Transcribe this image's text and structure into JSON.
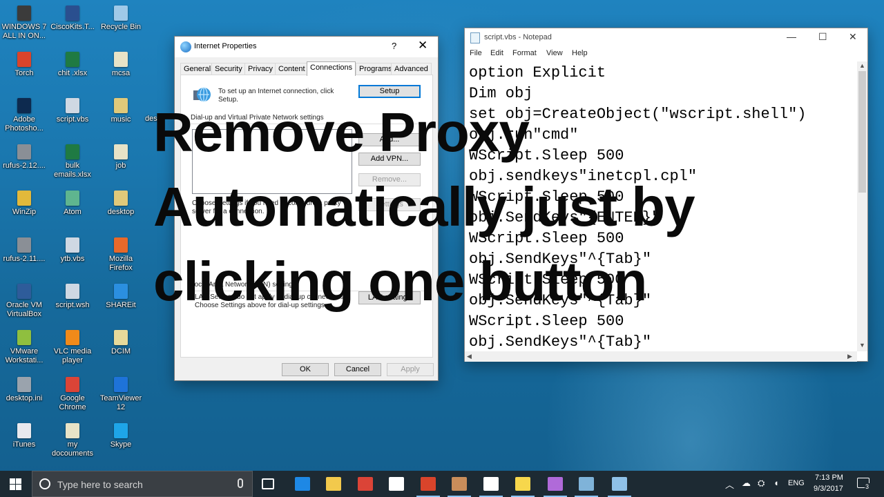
{
  "desktop": {
    "icons": [
      {
        "label": "WINDOWS 7 ALL IN ON...",
        "color": "#3b3b3b"
      },
      {
        "label": "CiscoKits.T...",
        "color": "#2a4f8f"
      },
      {
        "label": "Recycle Bin",
        "color": "#9fc9e8"
      },
      {
        "label": "Torch",
        "color": "#d9442b"
      },
      {
        "label": "chit .xlsx",
        "color": "#1f7a43"
      },
      {
        "label": "mcsa",
        "color": "#e7e3c7"
      },
      {
        "label": "Adobe Photosho...",
        "color": "#0d2a4f"
      },
      {
        "label": "script.vbs",
        "color": "#cfd8e3"
      },
      {
        "label": "music",
        "color": "#e0c97a"
      },
      {
        "label": "rufus-2.12....",
        "color": "#8a8f96"
      },
      {
        "label": "bulk emails.xlsx",
        "color": "#1f7a43"
      },
      {
        "label": "job",
        "color": "#e7e3c7"
      },
      {
        "label": "WinZip",
        "color": "#e2b93b"
      },
      {
        "label": "Atom",
        "color": "#5fb58f"
      },
      {
        "label": "desktop",
        "color": "#e0c97a"
      },
      {
        "label": "rufus-2.11....",
        "color": "#8a8f96"
      },
      {
        "label": "ytb.vbs",
        "color": "#cfd8e3"
      },
      {
        "label": "Mozilla Firefox",
        "color": "#e8692a"
      },
      {
        "label": "Oracle VM VirtualBox",
        "color": "#2e5c9a"
      },
      {
        "label": "script.wsh",
        "color": "#cfd8e3"
      },
      {
        "label": "SHAREit",
        "color": "#2b8fe0"
      },
      {
        "label": "VMware Workstati...",
        "color": "#8fbf3f"
      },
      {
        "label": "VLC media player",
        "color": "#f08a1a"
      },
      {
        "label": "DCIM",
        "color": "#e7d99a"
      },
      {
        "label": "desktop.ini",
        "color": "#9aa3ad"
      },
      {
        "label": "Google Chrome",
        "color": "#db4437"
      },
      {
        "label": "TeamViewer 12",
        "color": "#1e73d9"
      },
      {
        "label": "iTunes",
        "color": "#e9e9ee"
      },
      {
        "label": "my docouments",
        "color": "#e7e3c7"
      },
      {
        "label": "Skype",
        "color": "#1ea5e8"
      }
    ],
    "partial_label": "des"
  },
  "dialog": {
    "title": "Internet Properties",
    "help": "?",
    "close": "✕",
    "tabs": [
      "General",
      "Security",
      "Privacy",
      "Content",
      "Connections",
      "Programs",
      "Advanced"
    ],
    "active_tab": "Connections",
    "setup_text": "To set up an Internet connection, click Setup.",
    "setup_button": "Setup",
    "dialup_heading": "Dial-up and Virtual Private Network settings",
    "add_button": "Add...",
    "add_vpn_button": "Add VPN...",
    "remove_button": "Remove...",
    "settings_button": "Settings",
    "proxy_text": "Choose Settings if you need to configure a proxy server for a connection.",
    "lan_heading": "Local Area Network (LAN) settings",
    "lan_text": "LAN Settings do not apply to dial-up connections. Choose Settings above for dial-up settings.",
    "lan_button": "LAN settings",
    "ok": "OK",
    "cancel": "Cancel",
    "apply": "Apply"
  },
  "notepad": {
    "title": "script.vbs - Notepad",
    "minimize": "—",
    "maximize": "☐",
    "close": "✕",
    "menu": [
      "File",
      "Edit",
      "Format",
      "View",
      "Help"
    ],
    "lines": [
      "option Explicit",
      "Dim obj",
      "set obj=CreateObject(\"wscript.shell\")",
      "obj.run\"cmd\"",
      "WScript.Sleep 500",
      "obj.sendkeys\"inetcpl.cpl\"",
      "WScript.Sleep 500",
      "obj.SendKeys\"{ENTER}\"",
      "WScript.Sleep 500",
      "obj.SendKeys\"^{Tab}\"",
      "WScript.Sleep 500",
      "obj.SendKeys\"^{Tab}\"",
      "WScript.Sleep 500",
      "obj.SendKeys\"^{Tab}\""
    ]
  },
  "overlay": {
    "line1": "Remove Proxy",
    "line2": "Automatically just by",
    "line3": "clicking one button"
  },
  "taskbar": {
    "search_placeholder": "Type here to search",
    "apps": [
      {
        "name": "task-view",
        "color": "#ffffff"
      },
      {
        "name": "edge",
        "color": "#1e88e5"
      },
      {
        "name": "file-explorer",
        "color": "#f2c94c"
      },
      {
        "name": "chrome",
        "color": "#db4437"
      },
      {
        "name": "store",
        "color": "#ffffff"
      },
      {
        "name": "torch",
        "color": "#d9442b"
      },
      {
        "name": "paint",
        "color": "#c98d5a"
      },
      {
        "name": "mail",
        "color": "#ffffff"
      },
      {
        "name": "sticky-notes",
        "color": "#f7d74c"
      },
      {
        "name": "photos",
        "color": "#b06ad9"
      },
      {
        "name": "notepad",
        "color": "#7fb3d9"
      },
      {
        "name": "virtualbox",
        "color": "#8fc1e8"
      }
    ],
    "language": "ENG",
    "time": "7:13 PM",
    "date": "9/3/2017",
    "notifications": "3"
  }
}
